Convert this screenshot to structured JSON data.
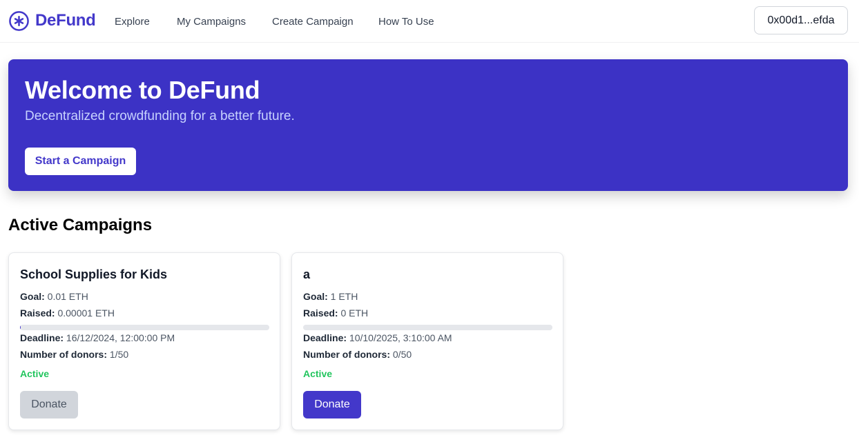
{
  "brand": {
    "name": "DeFund",
    "icon": "plus-circle-icon",
    "color": "#4338ca"
  },
  "nav": {
    "links": [
      "Explore",
      "My Campaigns",
      "Create Campaign",
      "How To Use"
    ],
    "wallet": "0x00d1...efda"
  },
  "hero": {
    "title": "Welcome to DeFund",
    "subtitle": "Decentralized crowdfunding for a better future.",
    "cta": "Start a Campaign",
    "background": "#3c32c5"
  },
  "campaigns": {
    "section_title": "Active Campaigns",
    "items": [
      {
        "title": "School Supplies for Kids",
        "goal_label": "Goal:",
        "goal": "0.01 ETH",
        "raised_label": "Raised:",
        "raised": "0.00001 ETH",
        "progress": 0.001,
        "deadline_label": "Deadline:",
        "deadline": "16/12/2024, 12:00:00 PM",
        "donors_label": "Number of donors:",
        "donors": "1/50",
        "status": "Active",
        "donate": "Donate",
        "donate_enabled": false
      },
      {
        "title": "a",
        "goal_label": "Goal:",
        "goal": "1 ETH",
        "raised_label": "Raised:",
        "raised": "0 ETH",
        "progress": 0,
        "deadline_label": "Deadline:",
        "deadline": "10/10/2025, 3:10:00 AM",
        "donors_label": "Number of donors:",
        "donors": "0/50",
        "status": "Active",
        "donate": "Donate",
        "donate_enabled": true
      }
    ]
  },
  "colors": {
    "accent": "#4338ca",
    "status_active": "#22c55e",
    "disabled": "#d1d5db"
  }
}
